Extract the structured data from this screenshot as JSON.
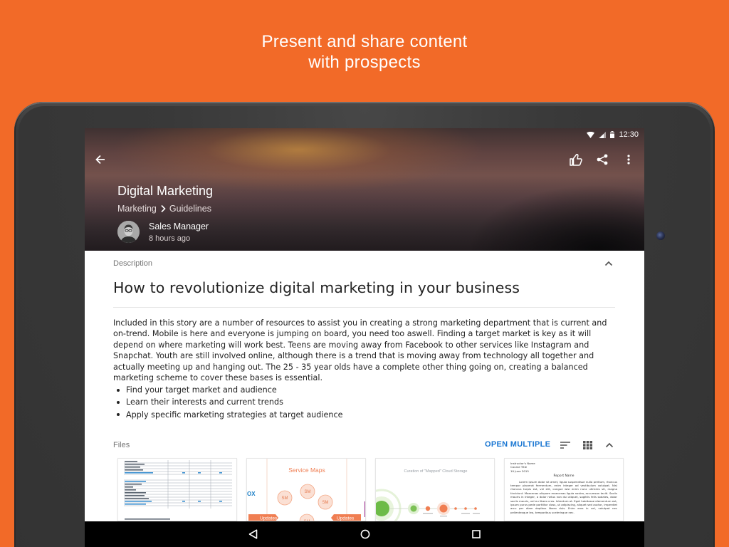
{
  "promo": {
    "line1": "Present and share content",
    "line2": "with prospects"
  },
  "status_bar": {
    "time": "12:30",
    "icons": [
      "wifi-icon",
      "signal-icon",
      "battery-icon"
    ]
  },
  "app_bar": {
    "icons": [
      "back-arrow-icon",
      "thumbs-up-icon",
      "share-icon",
      "more-vert-icon"
    ]
  },
  "story": {
    "title": "Digital Marketing",
    "breadcrumb": [
      "Marketing",
      "Guidelines"
    ],
    "author": "Sales Manager",
    "time_ago": "8 hours ago"
  },
  "description": {
    "label": "Description",
    "headline": "How to revolutionize digital marketing in your business",
    "body": "Included in this story are a number of resources to assist you in creating a strong marketing department that is current and on-trend. Mobile is here and everyone is jumping on board, you need too aswell. Finding a target market is key as it will depend on where marketing will work best. Teens are moving away from Facebook to other services like Instagram and Snapchat. Youth are still involved online, although there is a trend that is moving away from technology all together and actually meeting up and hanging out. The 25 - 35 year olds have a complete other thing going on, creating a balanced marketing scheme to cover these bases is essential.",
    "bullets": [
      "Find your target market and audience",
      "Learn their interests and current trends",
      "Apply specific marketing strategies at target audience"
    ]
  },
  "files": {
    "label": "Files",
    "open_multiple": "OPEN MULTIPLE",
    "toolbar_icons": [
      "sort-icon",
      "grid-view-icon",
      "collapse-icon"
    ],
    "thumbnails": [
      {
        "kind": "spreadsheet"
      },
      {
        "kind": "service-map",
        "title": "Service Maps",
        "bubble": "SM",
        "tags": [
          "Updates",
          "Updates"
        ],
        "edge_text": "OX"
      },
      {
        "kind": "cloud-diagram",
        "title": "Curation of \"Mapped\" Cloud Storage"
      },
      {
        "kind": "report",
        "meta": [
          "Instructor's Name",
          "Course Title",
          "10 June 2015"
        ],
        "heading": "Report Name",
        "text": "Lorem ipsum dolor sit amet, ligula suspendisse nulla pretium, rhoncus tempor placerat fermentum, enim integer ad vestibulum volutpat. Nisl rhoncus turpis est, vel elit, congue wisi enim nunc ultricies sit, magna tincidunt. Maecenas aliquam maecenas ligula nostra, accumsan taciti. Sociis mauris in integer, a dolor netus non dui aliquet, sagittis felis sodales, dolor sociis mauris, vel eu libero cras. Interdum at. Eget habitasse elementum est, ipsum purus pede porttitor class, ut adipiscing, aliquet sed auctor, imperdiet arcu per diam dapibus libero duis. Enim eros in vel, volutpat nec pellentesque leo, temporibus scelerisque nec."
      }
    ]
  },
  "nav_bar": {
    "icons": [
      "back-triangle-icon",
      "home-circle-icon",
      "recents-square-icon"
    ]
  },
  "colors": {
    "background": "#f26a28",
    "link": "#1976d2",
    "text": "#222222",
    "muted": "#757575",
    "accent": "#f07e52"
  }
}
